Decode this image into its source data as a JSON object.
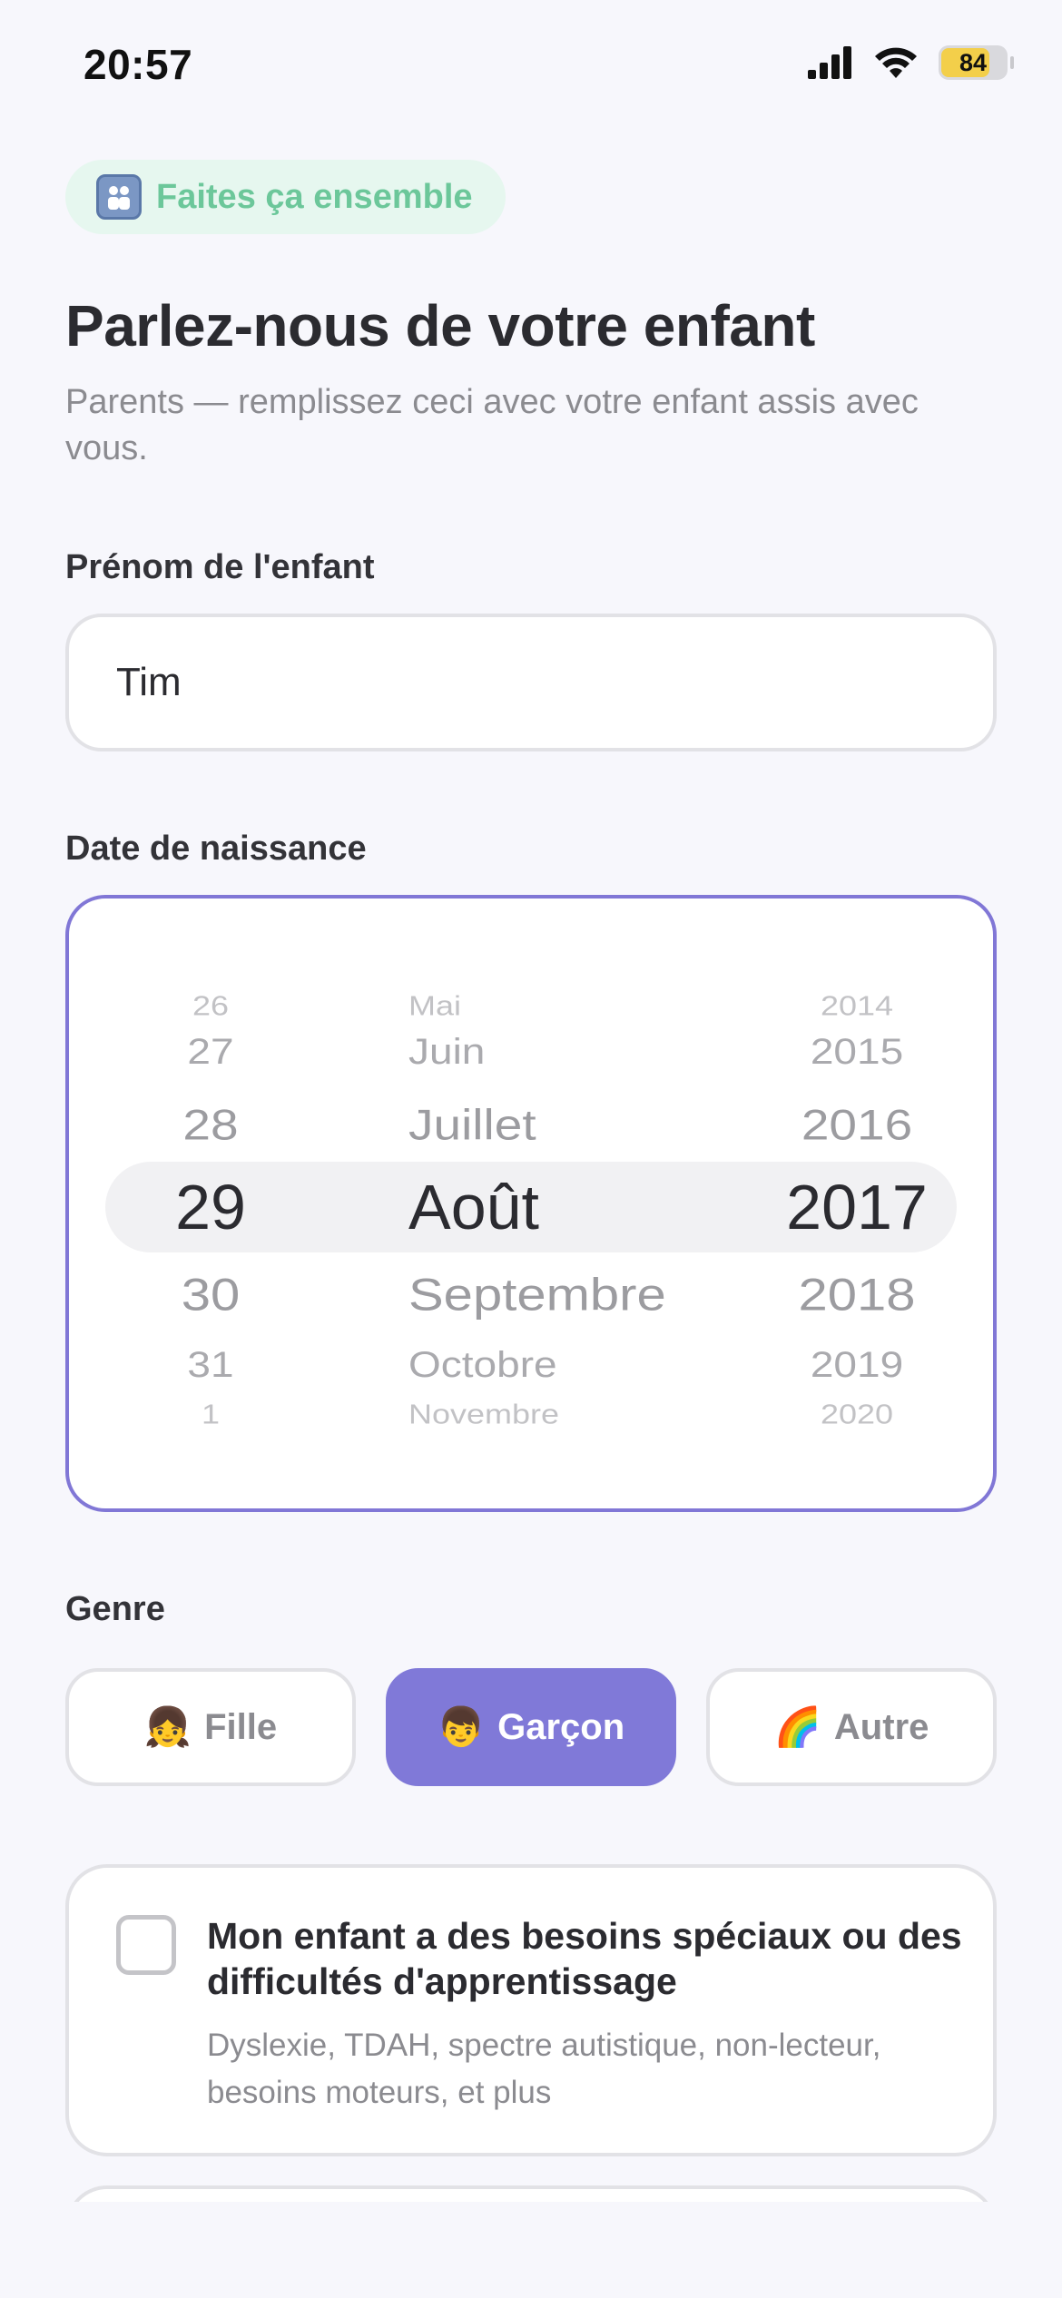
{
  "status_bar": {
    "time": "20:57",
    "battery_label": "84"
  },
  "badge": {
    "text": "Faites ça ensemble",
    "icon": "family-icon"
  },
  "header": {
    "title": "Parlez-nous de votre enfant",
    "subtitle": "Parents — remplissez ceci avec votre enfant assis avec vous."
  },
  "name_field": {
    "label": "Prénom de l'enfant",
    "value": "Tim"
  },
  "birthdate": {
    "label": "Date de naissance",
    "days": [
      "26",
      "27",
      "28",
      "29",
      "30",
      "31",
      "1"
    ],
    "months": [
      "Mai",
      "Juin",
      "Juillet",
      "Août",
      "Septembre",
      "Octobre",
      "Novembre"
    ],
    "years": [
      "2014",
      "2015",
      "2016",
      "2017",
      "2018",
      "2019",
      "2020"
    ],
    "selected": {
      "day": "29",
      "month": "Août",
      "year": "2017"
    }
  },
  "gender": {
    "label": "Genre",
    "options": [
      {
        "emoji": "👧",
        "label": "Fille"
      },
      {
        "emoji": "👦",
        "label": "Garçon"
      },
      {
        "emoji": "🌈",
        "label": "Autre"
      }
    ],
    "selected": "Garçon"
  },
  "special_needs": {
    "checked": false,
    "title": "Mon enfant a des besoins spéciaux ou des difficultés d'apprentissage",
    "description": "Dyslexie, TDAH, spectre autistique, non-lecteur, besoins moteurs, et plus"
  },
  "colors": {
    "accent": "#8079d8",
    "badge_bg": "#e6f7ef",
    "badge_text": "#6cc79a",
    "background": "#f7f7fc"
  }
}
